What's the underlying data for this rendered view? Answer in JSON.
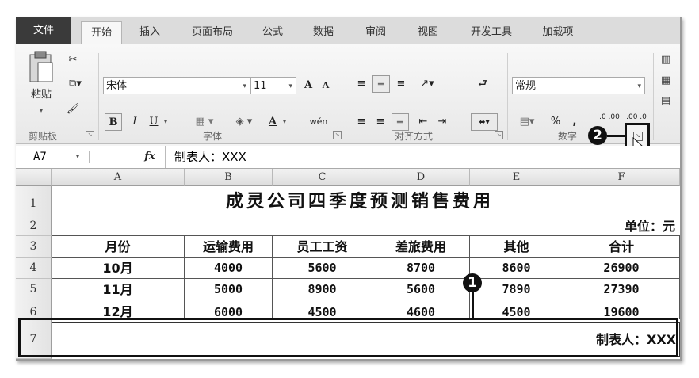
{
  "tabs": [
    "文件",
    "开始",
    "插入",
    "页面布局",
    "公式",
    "数据",
    "审阅",
    "视图",
    "开发工具",
    "加载项"
  ],
  "clipboard": {
    "paste_label": "粘贴",
    "group_label": "剪贴板"
  },
  "font": {
    "name": "宋体",
    "size": "11",
    "bold": "B",
    "italic": "I",
    "underline": "U",
    "font_color_letter": "A",
    "grow": "A",
    "shrink": "A",
    "phonetic": "wén",
    "group_label": "字体"
  },
  "alignment": {
    "group_label": "对齐方式"
  },
  "number": {
    "format": "常规",
    "percent": "%",
    "comma": ",",
    "dec_inc": ".0 .00",
    "dec_dec": ".00 .0",
    "group_label": "数字"
  },
  "formula_bar": {
    "cell_ref": "A7",
    "fx": "fx",
    "content": "制表人：XXX"
  },
  "columns": [
    "A",
    "B",
    "C",
    "D",
    "E",
    "F"
  ],
  "rows": [
    "1",
    "2",
    "3",
    "4",
    "5",
    "6",
    "7"
  ],
  "sheet": {
    "title": "成灵公司四季度预测销售费用",
    "unit": "单位：元",
    "headers": [
      "月份",
      "运输费用",
      "员工工资",
      "差旅费用",
      "其他",
      "合计"
    ],
    "data": [
      [
        "10月",
        "4000",
        "5600",
        "8700",
        "8600",
        "26900"
      ],
      [
        "11月",
        "5000",
        "8900",
        "5600",
        "7890",
        "27390"
      ],
      [
        "12月",
        "6000",
        "4500",
        "4600",
        "4500",
        "19600"
      ]
    ],
    "footer": "制表人：XXX"
  },
  "callouts": [
    "1",
    "2"
  ]
}
